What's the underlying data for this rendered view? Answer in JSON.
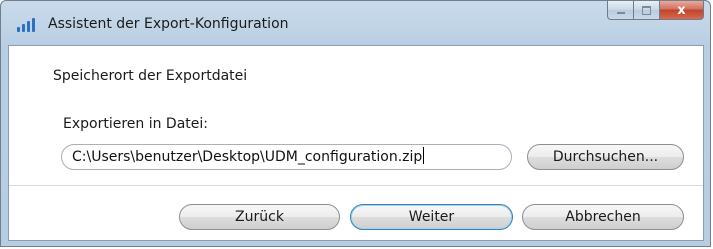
{
  "window": {
    "title": "Assistent der Export-Konfiguration",
    "icon": "app-bars-icon",
    "controls": {
      "minimize_icon": "minimize-icon",
      "maximize_icon": "maximize-icon",
      "close_icon": "close-icon",
      "close_glyph": "x"
    }
  },
  "content": {
    "heading": "Speicherort der Exportdatei",
    "field_label": "Exportieren in Datei:",
    "path_value": "C:\\Users\\benutzer\\Desktop\\UDM_configuration.zip",
    "browse_label": "Durchsuchen..."
  },
  "buttons": {
    "back": "Zurück",
    "next": "Weiter",
    "cancel": "Abbrechen"
  },
  "colors": {
    "titlebar": "#bfd3e6",
    "close_button": "#c0432c",
    "default_button_border": "#3c7fb1"
  }
}
